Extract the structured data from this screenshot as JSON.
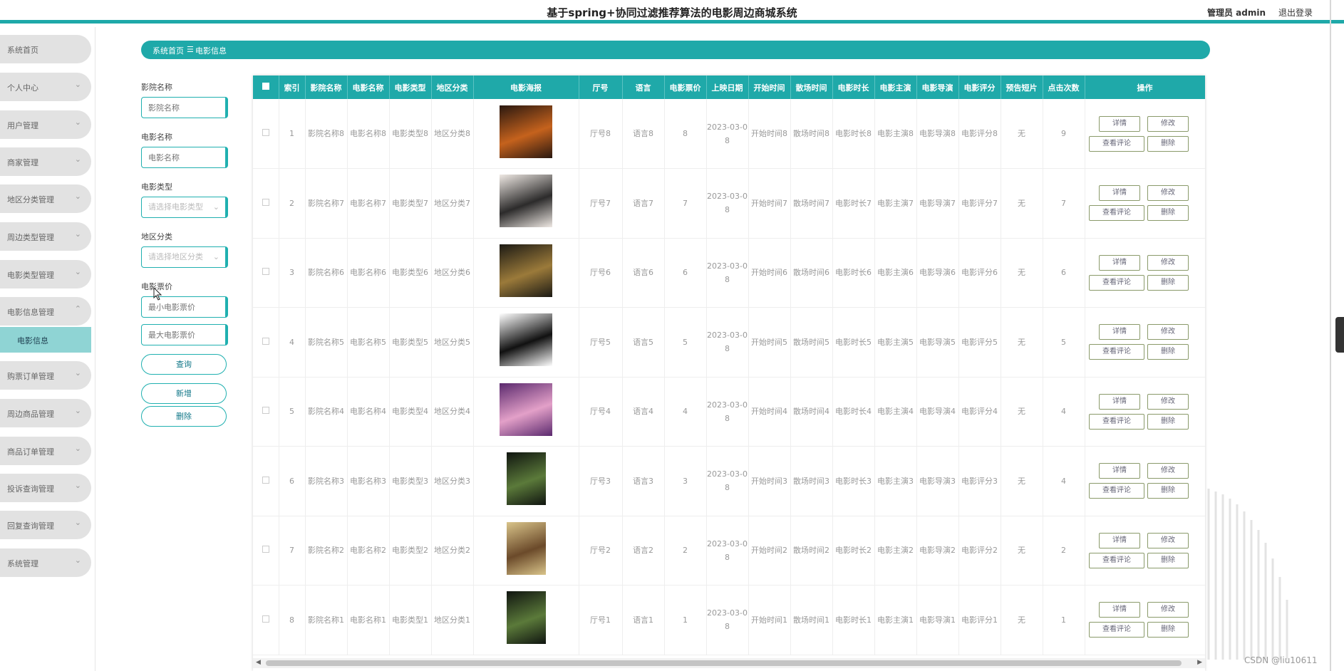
{
  "header": {
    "title": "基于spring+协同过滤推荐算法的电影周边商城系统",
    "user": "管理员 admin",
    "logout": "退出登录"
  },
  "sidebar": {
    "items": [
      "系统首页",
      "个人中心",
      "用户管理",
      "商家管理",
      "地区分类管理",
      "周边类型管理",
      "电影类型管理",
      "电影信息管理",
      "购票订单管理",
      "周边商品管理",
      "商品订单管理",
      "投诉查询管理",
      "回复查询管理",
      "系统管理"
    ],
    "sub_item": "电影信息"
  },
  "breadcrumb": {
    "home": "系统首页",
    "sep": "☰",
    "current": "电影信息"
  },
  "filters": {
    "cinema_label": "影院名称",
    "cinema_placeholder": "影院名称",
    "movie_label": "电影名称",
    "movie_placeholder": "电影名称",
    "type_label": "电影类型",
    "type_placeholder": "请选择电影类型",
    "region_label": "地区分类",
    "region_placeholder": "请选择地区分类",
    "price_label": "电影票价",
    "min_placeholder": "最小电影票价",
    "max_placeholder": "最大电影票价",
    "query": "查询",
    "add": "新增",
    "delete": "删除"
  },
  "table": {
    "headers": [
      "索引",
      "影院名称",
      "电影名称",
      "电影类型",
      "地区分类",
      "电影海报",
      "厅号",
      "语言",
      "电影票价",
      "上映日期",
      "开始时间",
      "散场时间",
      "电影时长",
      "电影主演",
      "电影导演",
      "电影评分",
      "预告短片",
      "点击次数",
      "操作"
    ],
    "buttons": {
      "detail": "详情",
      "edit": "修改",
      "comments": "查看评论",
      "delete": "删除"
    },
    "rows": [
      [
        "1",
        "影院名称8",
        "电影名称8",
        "电影类型8",
        "地区分类8",
        "",
        "厅号8",
        "语言8",
        "8",
        "2023-03-08",
        "开始时间8",
        "散场时间8",
        "电影时长8",
        "电影主演8",
        "电影导演8",
        "电影评分8",
        "无",
        "9"
      ],
      [
        "2",
        "影院名称7",
        "电影名称7",
        "电影类型7",
        "地区分类7",
        "",
        "厅号7",
        "语言7",
        "7",
        "2023-03-08",
        "开始时间7",
        "散场时间7",
        "电影时长7",
        "电影主演7",
        "电影导演7",
        "电影评分7",
        "无",
        "7"
      ],
      [
        "3",
        "影院名称6",
        "电影名称6",
        "电影类型6",
        "地区分类6",
        "",
        "厅号6",
        "语言6",
        "6",
        "2023-03-08",
        "开始时间6",
        "散场时间6",
        "电影时长6",
        "电影主演6",
        "电影导演6",
        "电影评分6",
        "无",
        "6"
      ],
      [
        "4",
        "影院名称5",
        "电影名称5",
        "电影类型5",
        "地区分类5",
        "",
        "厅号5",
        "语言5",
        "5",
        "2023-03-08",
        "开始时间5",
        "散场时间5",
        "电影时长5",
        "电影主演5",
        "电影导演5",
        "电影评分5",
        "无",
        "5"
      ],
      [
        "5",
        "影院名称4",
        "电影名称4",
        "电影类型4",
        "地区分类4",
        "",
        "厅号4",
        "语言4",
        "4",
        "2023-03-08",
        "开始时间4",
        "散场时间4",
        "电影时长4",
        "电影主演4",
        "电影导演4",
        "电影评分4",
        "无",
        "4"
      ],
      [
        "6",
        "影院名称3",
        "电影名称3",
        "电影类型3",
        "地区分类3",
        "",
        "厅号3",
        "语言3",
        "3",
        "2023-03-08",
        "开始时间3",
        "散场时间3",
        "电影时长3",
        "电影主演3",
        "电影导演3",
        "电影评分3",
        "无",
        "4"
      ],
      [
        "7",
        "影院名称2",
        "电影名称2",
        "电影类型2",
        "地区分类2",
        "",
        "厅号2",
        "语言2",
        "2",
        "2023-03-08",
        "开始时间2",
        "散场时间2",
        "电影时长2",
        "电影主演2",
        "电影导演2",
        "电影评分2",
        "无",
        "2"
      ],
      [
        "8",
        "影院名称1",
        "电影名称1",
        "电影类型1",
        "地区分类1",
        "",
        "厅号1",
        "语言1",
        "1",
        "2023-03-08",
        "开始时间1",
        "散场时间1",
        "电影时长1",
        "电影主演1",
        "电影导演1",
        "电影评分1",
        "无",
        "1"
      ]
    ]
  },
  "watermark": "CSDN @liu10611",
  "colors": {
    "accent": "#1fa9a9",
    "submenu": "#8fd4d4",
    "menu_bg": "#e2e2e2"
  }
}
